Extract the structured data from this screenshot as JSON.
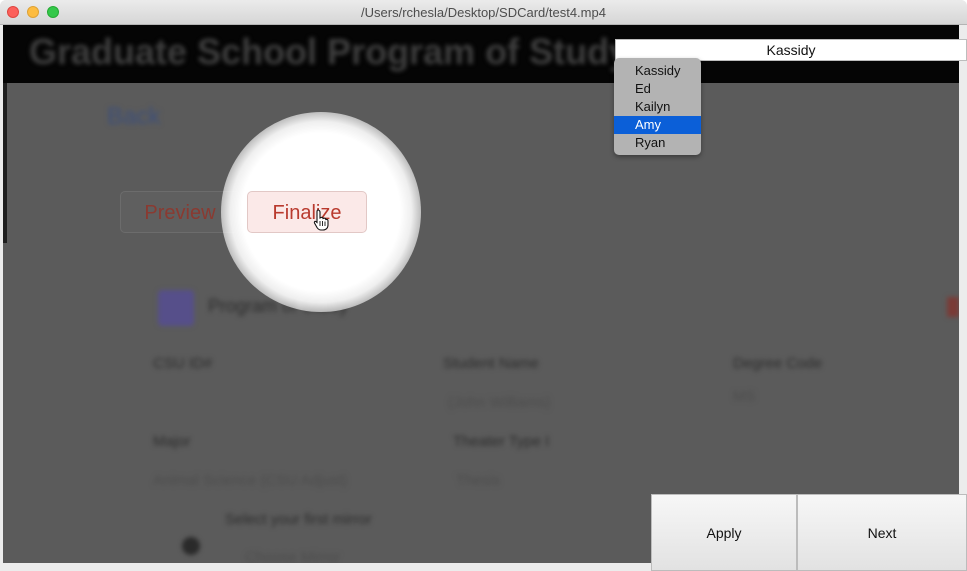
{
  "window": {
    "title": "/Users/rchesla/Desktop/SDCard/test4.mp4"
  },
  "video": {
    "header_text": "Graduate School Program of Study",
    "back_link": "Back",
    "preview_button": "Preview",
    "finalize_button": "Finalize",
    "section_title": "Program of Study",
    "fields": [
      {
        "label": "CSU ID#",
        "value": ""
      },
      {
        "label": "Student Name",
        "value": "(John Williams)"
      },
      {
        "label": "Degree Code",
        "value": "MS"
      },
      {
        "label": "Major",
        "value": "Theater Type I"
      },
      {
        "label": "Animal Science (CSU Adjust)",
        "value": "Thesis"
      },
      {
        "label": "Select your first mirror",
        "value": "Choose Mirror"
      }
    ]
  },
  "selector": {
    "current_value": "Kassidy",
    "options": [
      "Kassidy",
      "Ed",
      "Kailyn",
      "Amy",
      "Ryan"
    ],
    "highlighted": "Amy"
  },
  "actions": {
    "apply_label": "Apply",
    "next_label": "Next"
  }
}
